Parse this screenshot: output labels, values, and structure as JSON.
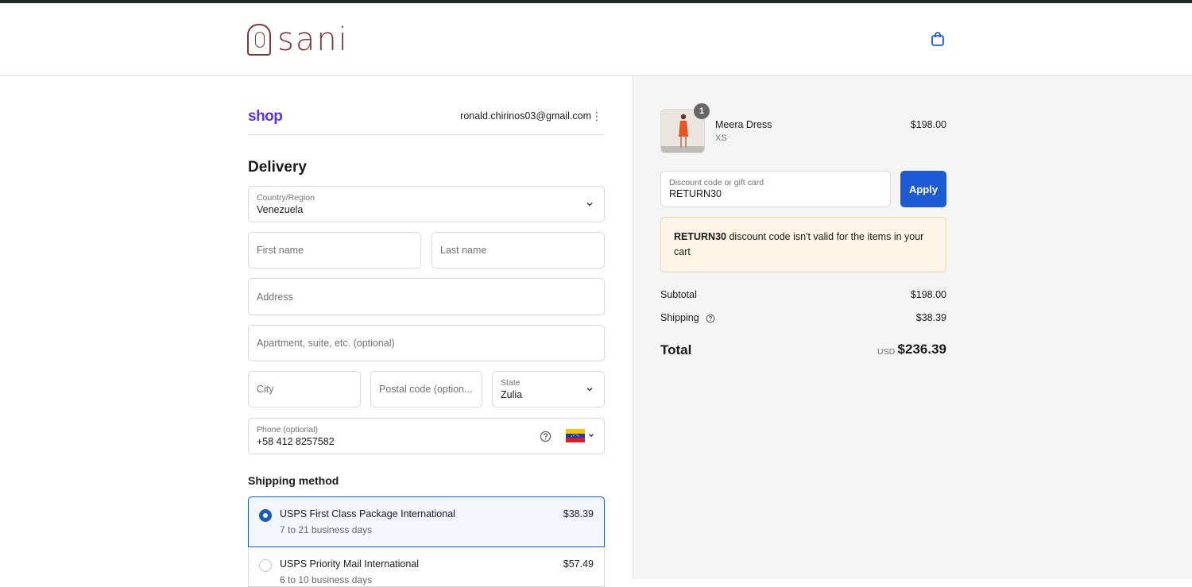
{
  "brand": {
    "logo_text": "sani"
  },
  "header": {
    "cart_icon": "shopping-bag-icon"
  },
  "account": {
    "shop_logo": "shop",
    "email": "ronald.chirinos03@gmail.com",
    "menu_glyph": "⋮"
  },
  "delivery": {
    "heading": "Delivery",
    "country": {
      "label": "Country/Region",
      "value": "Venezuela"
    },
    "first_name": {
      "placeholder": "First name"
    },
    "last_name": {
      "placeholder": "Last name"
    },
    "address": {
      "placeholder": "Address"
    },
    "apartment": {
      "placeholder": "Apartment, suite, etc. (optional)"
    },
    "city": {
      "placeholder": "City"
    },
    "postal": {
      "placeholder": "Postal code (option..."
    },
    "state": {
      "label": "State",
      "value": "Zulia"
    },
    "phone": {
      "label": "Phone (optional)",
      "value": "+58 412 8257582",
      "flag": "venezuela-flag"
    }
  },
  "shipping": {
    "heading": "Shipping method",
    "options": [
      {
        "name": "USPS First Class Package International",
        "eta": "7 to 21 business days",
        "price": "$38.39",
        "selected": true
      },
      {
        "name": "USPS Priority Mail International",
        "eta": "6 to 10 business days",
        "price": "$57.49",
        "selected": false
      }
    ]
  },
  "order": {
    "item": {
      "name": "Meera Dress",
      "variant": "XS",
      "price": "$198.00",
      "quantity": "1"
    },
    "discount": {
      "label": "Discount code or gift card",
      "value": "RETURN30",
      "button": "Apply"
    },
    "warning": {
      "code": "RETURN30",
      "message": " discount code isn't valid for the items in your cart"
    },
    "subtotal_label": "Subtotal",
    "subtotal": "$198.00",
    "shipping_label": "Shipping",
    "shipping": "$38.39",
    "total_label": "Total",
    "currency": "USD",
    "total": "$236.39"
  },
  "colors": {
    "accent": "#1c5bd3",
    "brand": "#7a3a3a",
    "shop": "#5a31f4",
    "warning_bg": "#fff4e6"
  }
}
